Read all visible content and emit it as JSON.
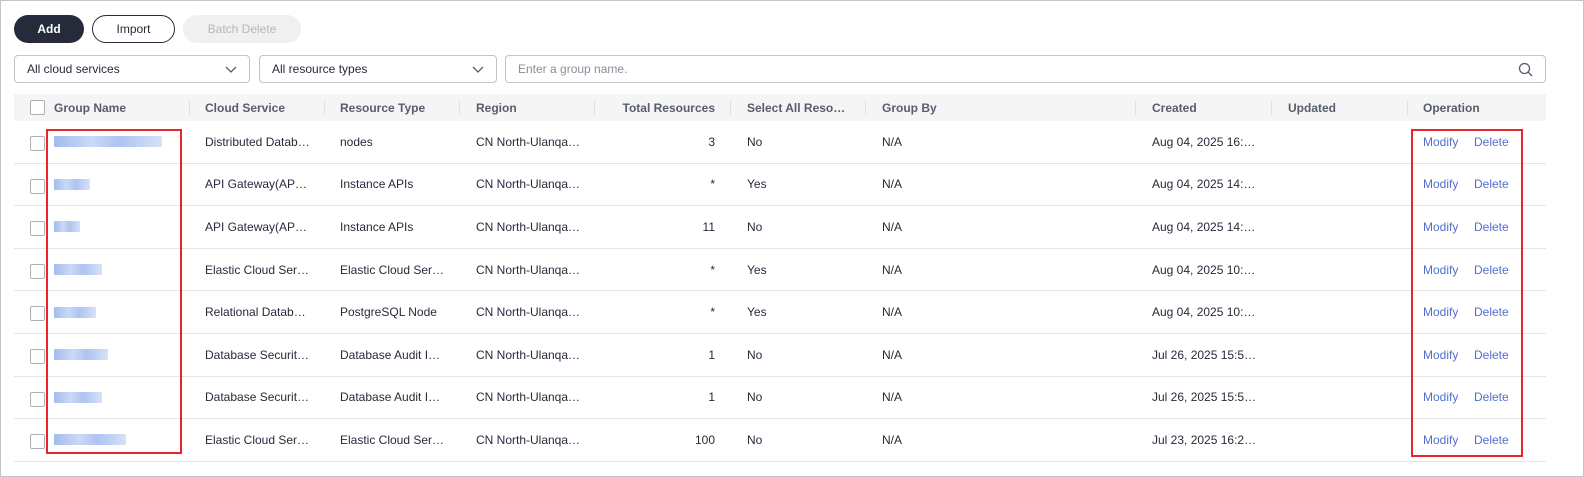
{
  "toolbar": {
    "add_label": "Add",
    "import_label": "Import",
    "batch_delete_label": "Batch Delete"
  },
  "filters": {
    "cloud_service_selected": "All cloud services",
    "resource_type_selected": "All resource types",
    "search_placeholder": "Enter a group name."
  },
  "table": {
    "headers": {
      "group_name": "Group Name",
      "cloud_service": "Cloud Service",
      "resource_type": "Resource Type",
      "region": "Region",
      "total_resources": "Total Resources",
      "select_all": "Select All Reso…",
      "group_by": "Group By",
      "created": "Created",
      "updated": "Updated",
      "operation": "Operation"
    },
    "modify_label": "Modify",
    "delete_label": "Delete",
    "rows": [
      {
        "cloud_service": "Distributed Datab…",
        "resource_type": "nodes",
        "region": "CN North-Ulanqa…",
        "total": "3",
        "select_all": "No",
        "group_by": "N/A",
        "created": "Aug 04, 2025 16:…",
        "updated": ""
      },
      {
        "cloud_service": "API Gateway(AP…",
        "resource_type": "Instance APIs",
        "region": "CN North-Ulanqa…",
        "total": "*",
        "select_all": "Yes",
        "group_by": "N/A",
        "created": "Aug 04, 2025 14:…",
        "updated": ""
      },
      {
        "cloud_service": "API Gateway(AP…",
        "resource_type": "Instance APIs",
        "region": "CN North-Ulanqa…",
        "total": "11",
        "select_all": "No",
        "group_by": "N/A",
        "created": "Aug 04, 2025 14:…",
        "updated": ""
      },
      {
        "cloud_service": "Elastic Cloud Ser…",
        "resource_type": "Elastic Cloud Ser…",
        "region": "CN North-Ulanqa…",
        "total": "*",
        "select_all": "Yes",
        "group_by": "N/A",
        "created": "Aug 04, 2025 10:…",
        "updated": ""
      },
      {
        "cloud_service": "Relational Datab…",
        "resource_type": "PostgreSQL Node",
        "region": "CN North-Ulanqa…",
        "total": "*",
        "select_all": "Yes",
        "group_by": "N/A",
        "created": "Aug 04, 2025 10:…",
        "updated": ""
      },
      {
        "cloud_service": "Database Securit…",
        "resource_type": "Database Audit I…",
        "region": "CN North-Ulanqa…",
        "total": "1",
        "select_all": "No",
        "group_by": "N/A",
        "created": "Jul 26, 2025 15:5…",
        "updated": ""
      },
      {
        "cloud_service": "Database Securit…",
        "resource_type": "Database Audit I…",
        "region": "CN North-Ulanqa…",
        "total": "1",
        "select_all": "No",
        "group_by": "N/A",
        "created": "Jul 26, 2025 15:5…",
        "updated": ""
      },
      {
        "cloud_service": "Elastic Cloud Ser…",
        "resource_type": "Elastic Cloud Ser…",
        "region": "CN North-Ulanqa…",
        "total": "100",
        "select_all": "No",
        "group_by": "N/A",
        "created": "Jul 23, 2025 16:2…",
        "updated": ""
      }
    ]
  },
  "colors": {
    "primary_button": "#252b3a",
    "link": "#526ecc",
    "highlight_border": "#e8262a",
    "header_background": "#f5f5f5"
  },
  "icons": [
    "chevron-down-icon",
    "search-icon",
    "checkbox"
  ]
}
